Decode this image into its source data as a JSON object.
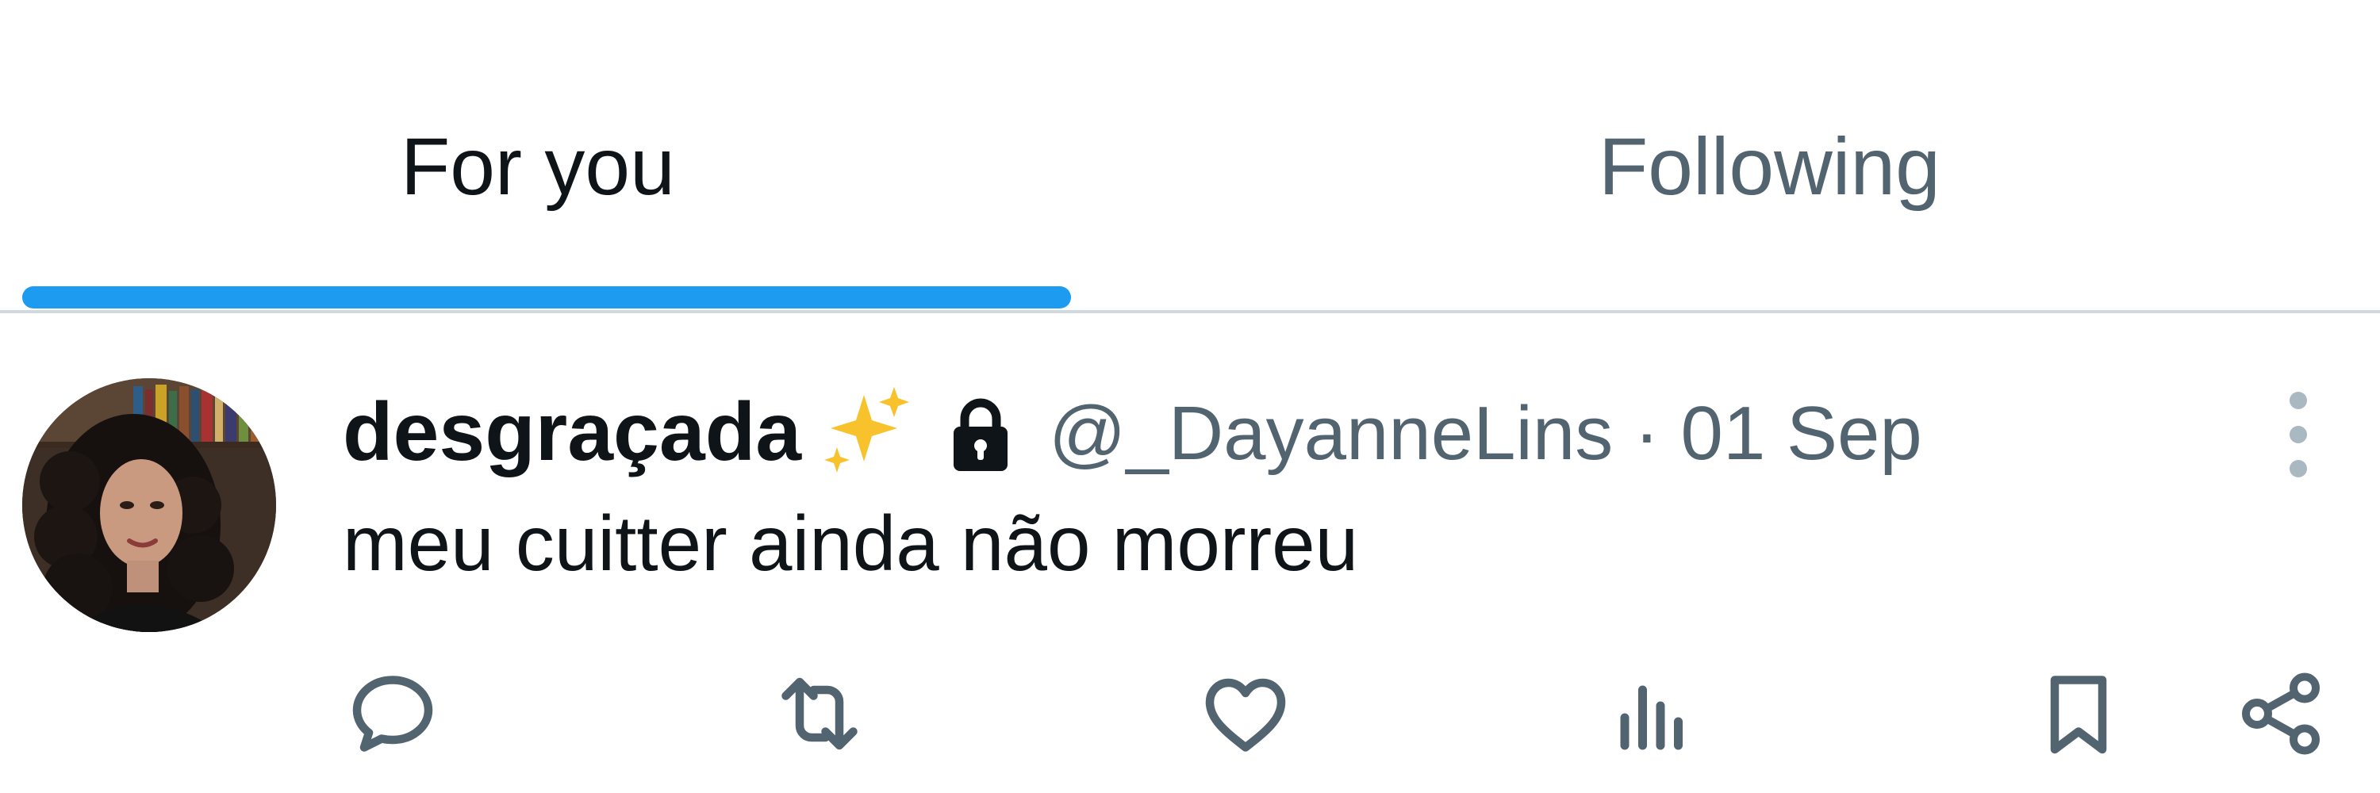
{
  "tabs": [
    {
      "label": "For you",
      "selected": true
    },
    {
      "label": "Following",
      "selected": false
    }
  ],
  "colors": {
    "accent": "#1d9bf0",
    "text_primary": "#0f1419",
    "text_secondary": "#536471",
    "divider": "#cfd9de"
  },
  "tweet": {
    "display_name": "desgraçada",
    "display_name_emoji": "sparkles-icon",
    "protected_icon": "lock-icon",
    "handle": "@_DayanneLins",
    "separator": "·",
    "date": "01 Sep",
    "handle_line": "@_DayanneLins · 01 Sep",
    "text": "meu cuitter ainda não morreu",
    "more_icon": "more-vertical-icon",
    "actions": [
      {
        "icon": "reply-icon"
      },
      {
        "icon": "retweet-icon"
      },
      {
        "icon": "like-icon"
      },
      {
        "icon": "views-icon"
      },
      {
        "icon": "bookmark-icon"
      },
      {
        "icon": "share-icon"
      }
    ]
  }
}
